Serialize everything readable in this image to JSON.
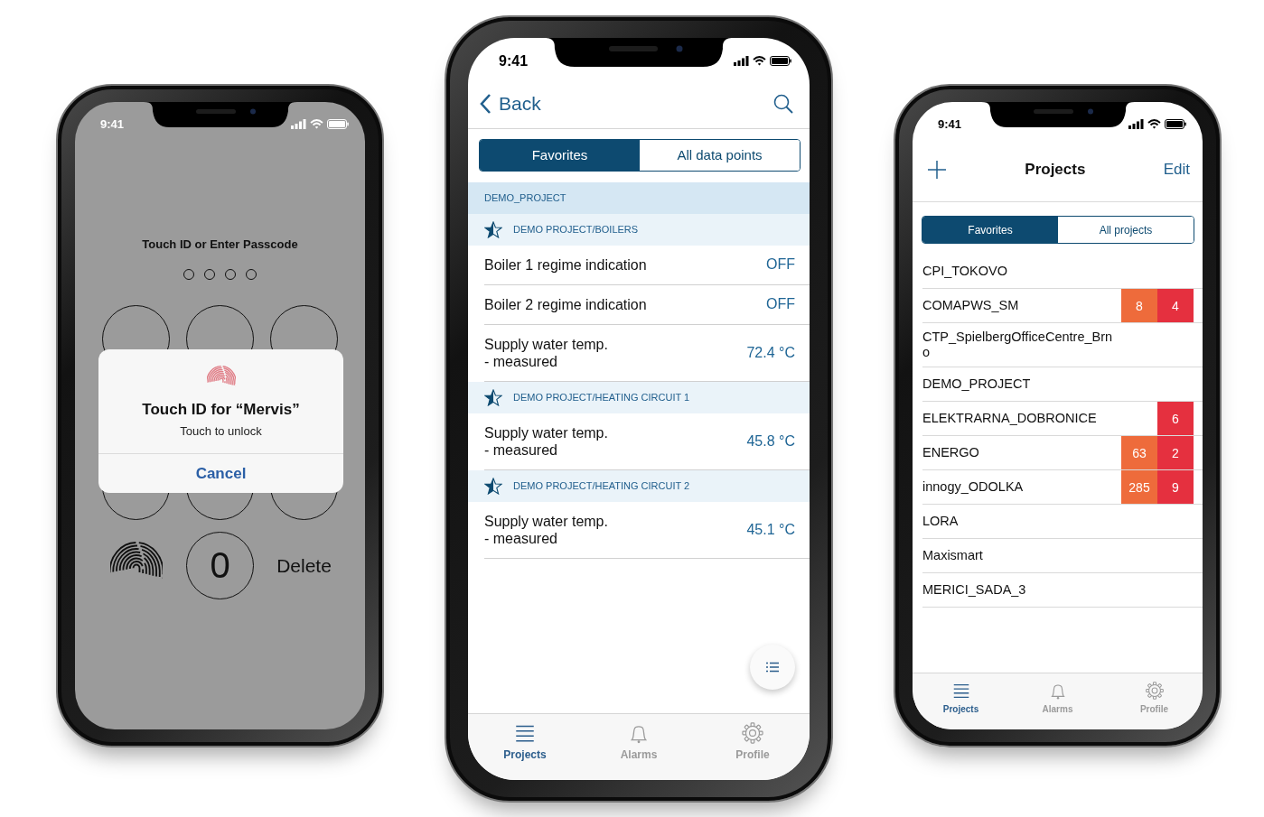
{
  "phones": [
    {
      "kind": "lock",
      "status_bar": {
        "time": "9:41"
      },
      "prompt": "Touch ID or Enter Passcode",
      "passcode_dots": [
        {
          "filled": false
        },
        {
          "filled": false
        },
        {
          "filled": false
        },
        {
          "filled": false
        }
      ],
      "keypad": {
        "zero": "0",
        "delete": "Delete"
      },
      "dialog": {
        "title": "Touch ID for “Mervis”",
        "subtitle": "Touch to unlock",
        "button": "Cancel"
      }
    },
    {
      "kind": "datapoints",
      "status_bar": {
        "time": "9:41"
      },
      "nav": {
        "back": "Back"
      },
      "segments": [
        {
          "label": "Favorites",
          "selected": true
        },
        {
          "label": "All data points",
          "selected": false
        }
      ],
      "section": "DEMO_PROJECT",
      "groups": [
        {
          "title": "DEMO PROJECT/BOILERS",
          "rows": [
            {
              "label": "Boiler 1 regime indication",
              "value": "OFF"
            },
            {
              "label": "Boiler 2 regime indication",
              "value": "OFF"
            },
            {
              "label": "Supply water temp.\n- measured",
              "value": "72.4 °C"
            }
          ]
        },
        {
          "title": "DEMO PROJECT/HEATING CIRCUIT 1",
          "rows": [
            {
              "label": "Supply water temp.\n- measured",
              "value": "45.8 °C"
            }
          ]
        },
        {
          "title": "DEMO PROJECT/HEATING CIRCUIT 2",
          "rows": [
            {
              "label": "Supply water temp.\n- measured",
              "value": "45.1 °C"
            }
          ]
        }
      ],
      "tabs": [
        {
          "label": "Projects",
          "selected": true
        },
        {
          "label": "Alarms",
          "selected": false
        },
        {
          "label": "Profile",
          "selected": false
        }
      ]
    },
    {
      "kind": "projects",
      "status_bar": {
        "time": "9:41"
      },
      "nav": {
        "title": "Projects",
        "edit": "Edit"
      },
      "segments": [
        {
          "label": "Favorites",
          "selected": true
        },
        {
          "label": "All projects",
          "selected": false
        }
      ],
      "projects": [
        {
          "name": "CPI_TOKOVO"
        },
        {
          "name": "COMAPWS_SM",
          "badges": [
            {
              "count": "8",
              "color": "#ee6b3b"
            },
            {
              "count": "4",
              "color": "#e5303f"
            }
          ]
        },
        {
          "name": "CTP_SpielbergOfficeCentre_Brno"
        },
        {
          "name": "DEMO_PROJECT"
        },
        {
          "name": "ELEKTRARNA_DOBRONICE",
          "badges": [
            {
              "count": "6",
              "color": "#e5303f"
            }
          ]
        },
        {
          "name": "ENERGO",
          "badges": [
            {
              "count": "63",
              "color": "#ee6b3b"
            },
            {
              "count": "2",
              "color": "#e5303f"
            }
          ]
        },
        {
          "name": "innogy_ODOLKA",
          "badges": [
            {
              "count": "285",
              "color": "#ee6b3b"
            },
            {
              "count": "9",
              "color": "#e5303f"
            }
          ]
        },
        {
          "name": "LORA"
        },
        {
          "name": "Maxismart"
        },
        {
          "name": "MERICI_SADA_3"
        }
      ],
      "tabs": [
        {
          "label": "Projects",
          "selected": true
        },
        {
          "label": "Alarms",
          "selected": false
        },
        {
          "label": "Profile",
          "selected": false
        }
      ]
    }
  ]
}
